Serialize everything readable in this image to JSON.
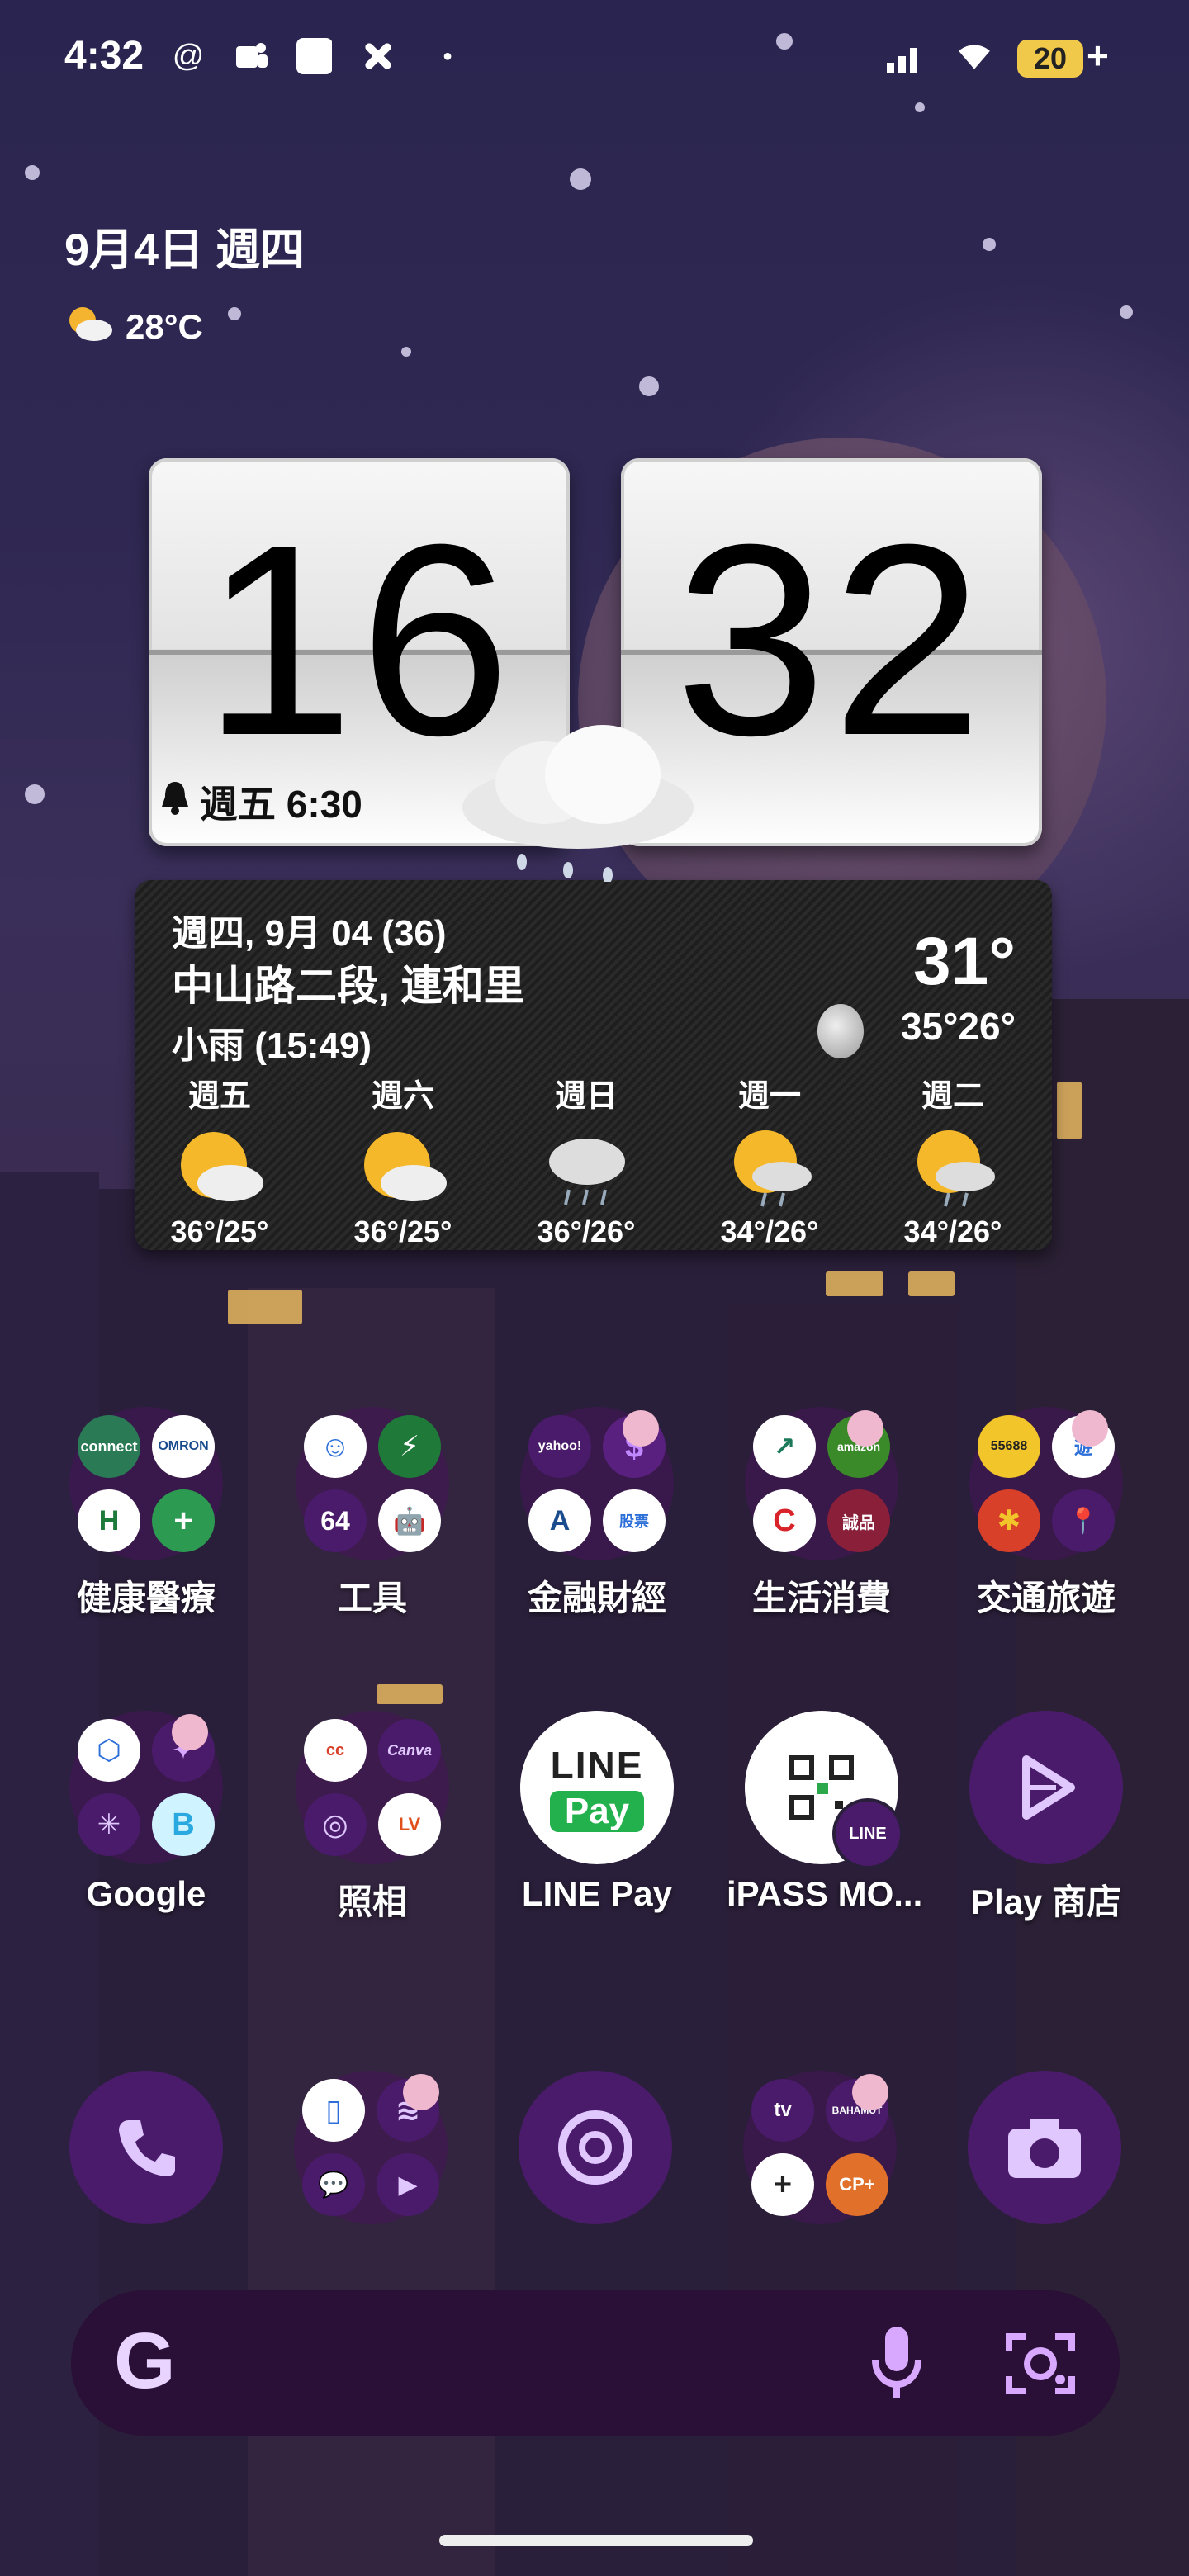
{
  "status_bar": {
    "time": "4:32",
    "battery": "20",
    "battery_charging": "+",
    "icons": [
      "threads-icon",
      "teams-icon",
      "white-square-icon",
      "slack-icon",
      "dot-icon",
      "signal-icon",
      "wifi-icon",
      "battery-icon"
    ]
  },
  "home": {
    "date": "9月4日 週四",
    "weather_temp": "28°C"
  },
  "clock": {
    "hour": "16",
    "minute": "32",
    "alarm": "週五 6:30"
  },
  "weather": {
    "date_line": "週四, 9月 04 (36)",
    "location": "中山路二段, 連和里",
    "condition": "小雨 (15:49)",
    "current": "31°",
    "hilo": "35°26°",
    "forecast": [
      {
        "day": "週五",
        "temp": "36°/25°",
        "icon": "sun-cloud"
      },
      {
        "day": "週六",
        "temp": "36°/25°",
        "icon": "sun-cloud"
      },
      {
        "day": "週日",
        "temp": "36°/26°",
        "icon": "rain-cloud"
      },
      {
        "day": "週一",
        "temp": "34°/26°",
        "icon": "sun-rain"
      },
      {
        "day": "週二",
        "temp": "34°/26°",
        "icon": "sun-rain"
      }
    ]
  },
  "apps_row1": [
    {
      "label": "健康醫療",
      "minis": [
        "connect",
        "OMRON",
        "H",
        "+"
      ]
    },
    {
      "label": "工具",
      "minis": [
        "☺",
        "⚡",
        "64",
        "🤖"
      ]
    },
    {
      "label": "金融財經",
      "minis": [
        "yahoo!",
        "$",
        "A",
        "股票"
      ]
    },
    {
      "label": "生活消費",
      "minis": [
        "↗",
        "amazon",
        "C",
        "誠品"
      ]
    },
    {
      "label": "交通旅遊",
      "minis": [
        "55688",
        "遊",
        "✱",
        "📍"
      ]
    }
  ],
  "apps_row2": [
    {
      "label": "Google",
      "minis": [
        "⬡",
        "✦",
        "✳",
        "B"
      ]
    },
    {
      "label": "照相",
      "minis": [
        "cc",
        "Canva",
        "◎",
        "LV"
      ]
    },
    {
      "label": "LINE Pay",
      "line_top": "LINE",
      "line_bottom": "Pay"
    },
    {
      "label": "iPASS MO...",
      "badge": "LINE"
    },
    {
      "label": "Play 商店"
    }
  ],
  "dock": {
    "folder2_minis": [
      "▯",
      "≋",
      "💬",
      "▶"
    ],
    "folder4_minis": [
      "tv",
      "BAHAMUT",
      "+",
      "CP+"
    ]
  },
  "search": {
    "g_label": "G"
  }
}
